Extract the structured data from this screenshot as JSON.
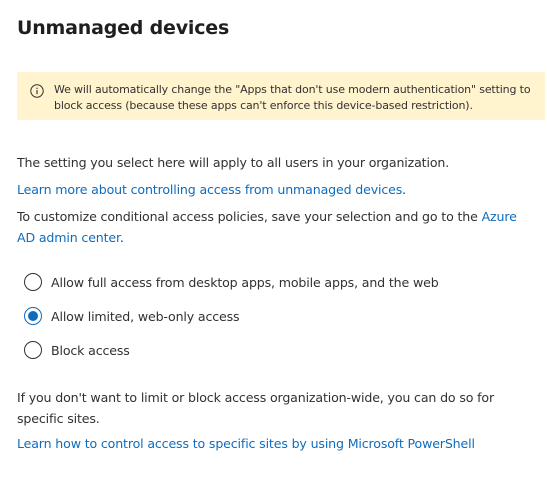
{
  "page": {
    "title": "Unmanaged devices"
  },
  "banner": {
    "icon": "info-icon",
    "text": "We will automatically change the \"Apps that don't use modern authentication\" setting to block access (because these apps can't enforce this device-based restriction)."
  },
  "intro": {
    "setting_text": "The setting you select here will apply to all users in your organization.",
    "learn_more_link": "Learn more about controlling access from unmanaged devices",
    "learn_more_suffix": ".",
    "customize_text": "To customize conditional access policies, save your selection and go to the ",
    "azure_link": "Azure AD admin center",
    "azure_suffix": "."
  },
  "access_options": [
    {
      "label": "Allow full access from desktop apps, mobile apps, and the web",
      "selected": false
    },
    {
      "label": "Allow limited, web-only access",
      "selected": true
    },
    {
      "label": "Block access",
      "selected": false
    }
  ],
  "footer": {
    "site_text": "If you don't want to limit or block access organization-wide, you can do so for specific sites.",
    "powershell_link": "Learn how to control access to specific sites by using Microsoft PowerShell"
  },
  "colors": {
    "accent": "#0f6cbd",
    "banner_background": "#fff4ce",
    "text": "#323130"
  }
}
